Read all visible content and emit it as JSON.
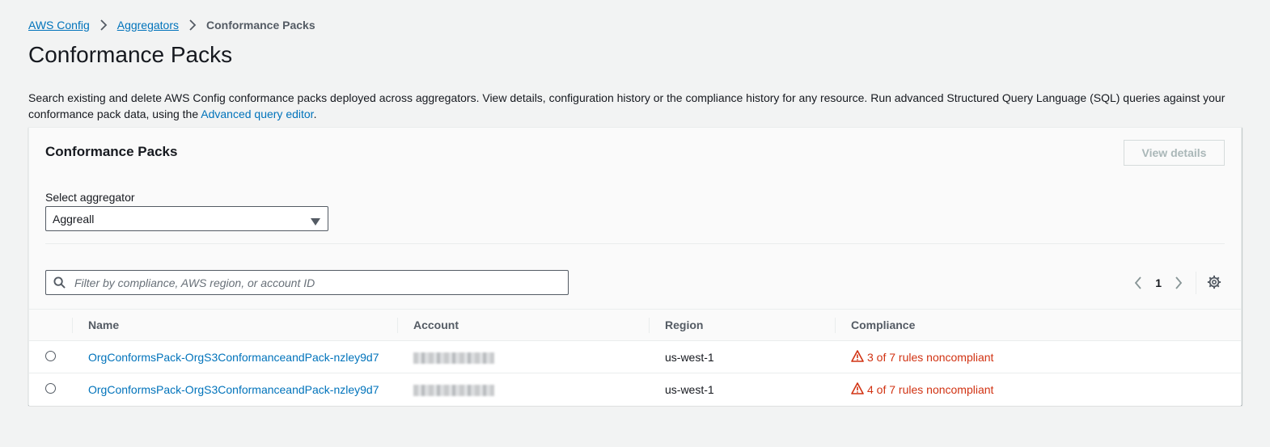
{
  "breadcrumb": {
    "items": [
      "AWS Config",
      "Aggregators"
    ],
    "current": "Conformance Packs"
  },
  "page": {
    "title": "Conformance Packs",
    "description_text": "Search existing and delete AWS Config conformance packs deployed across aggregators. View details, configuration history or the compliance history for any resource. Run advanced Structured Query Language (SQL) queries against your conformance pack data, using the ",
    "description_link": "Advanced query editor",
    "description_end": "."
  },
  "panel": {
    "title": "Conformance Packs",
    "view_details_label": "View details",
    "aggregator_label": "Select aggregator",
    "aggregator_value": "Aggreall",
    "filter_placeholder": "Filter by compliance, AWS region, or account ID",
    "page_number": "1"
  },
  "table": {
    "headers": [
      "Name",
      "Account",
      "Region",
      "Compliance"
    ],
    "rows": [
      {
        "name": "OrgConformsPack-OrgS3ConformanceandPack-nzley9d7",
        "region": "us-west-1",
        "compliance": "3 of 7 rules noncompliant"
      },
      {
        "name": "OrgConformsPack-OrgS3ConformanceandPack-nzley9d7",
        "region": "us-west-1",
        "compliance": "4 of 7 rules noncompliant"
      }
    ]
  },
  "colors": {
    "link": "#0073bb",
    "error": "#d13212",
    "disabled": "#aab7b8",
    "background": "#f2f3f3"
  },
  "icons": [
    "chevron-right-icon",
    "caret-down-icon",
    "search-icon",
    "chevron-left-icon",
    "settings-gear-icon",
    "warning-triangle-icon"
  ]
}
